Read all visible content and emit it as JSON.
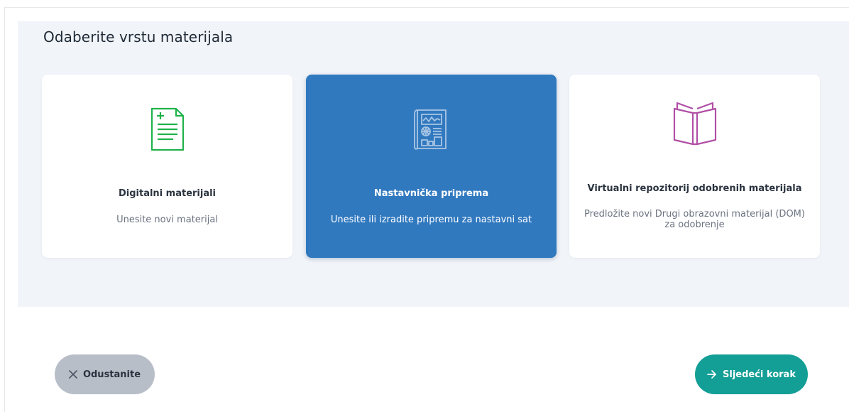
{
  "page": {
    "title": "Odaberite vrstu materijala"
  },
  "cards": [
    {
      "title": "Digitalni materijali",
      "description": "Unesite novi materijal",
      "icon": "document-add-icon",
      "icon_color": "#1fb24a",
      "selected": false
    },
    {
      "title": "Nastavnička priprema",
      "description": "Unesite ili izradite pripremu za nastavni sat",
      "icon": "newspaper-plan-icon",
      "icon_color": "#a9c6e4",
      "selected": true
    },
    {
      "title": "Virtualni repozitorij odobrenih materijala",
      "description": "Predložite novi Drugi obrazovni materijal (DOM) za odobrenje",
      "icon": "open-book-icon",
      "icon_color": "#b04fa6",
      "selected": false
    }
  ],
  "actions": {
    "cancel_label": "Odustanite",
    "cancel_icon": "close-icon",
    "next_label": "Sljedeći korak",
    "next_icon": "arrow-right-icon"
  },
  "colors": {
    "panel_bg": "#f1f4f8",
    "selected_card": "#3179bf",
    "primary_button": "#139e96",
    "secondary_button": "#b8bec8"
  }
}
